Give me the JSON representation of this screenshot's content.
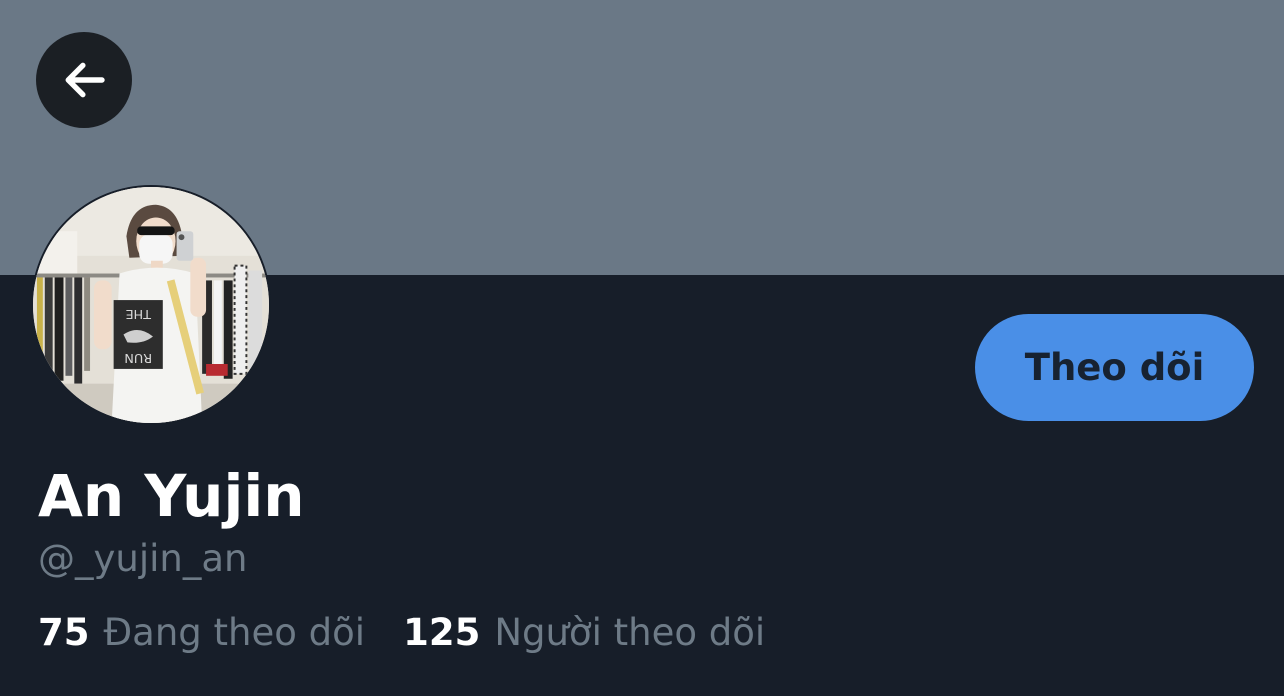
{
  "header": {
    "back_icon": "arrow-left-icon",
    "banner_color": "#6a7886"
  },
  "profile": {
    "display_name": "An Yujin",
    "handle": "@_yujin_an",
    "follow_label": "Theo dõi",
    "follow_color": "#4a8fe7",
    "avatar_shirt_text_top": "THE",
    "avatar_shirt_text_bottom": "RUN"
  },
  "stats": {
    "following_count": "75",
    "following_label": "Đang theo dõi",
    "followers_count": "125",
    "followers_label": "Người theo dõi"
  }
}
